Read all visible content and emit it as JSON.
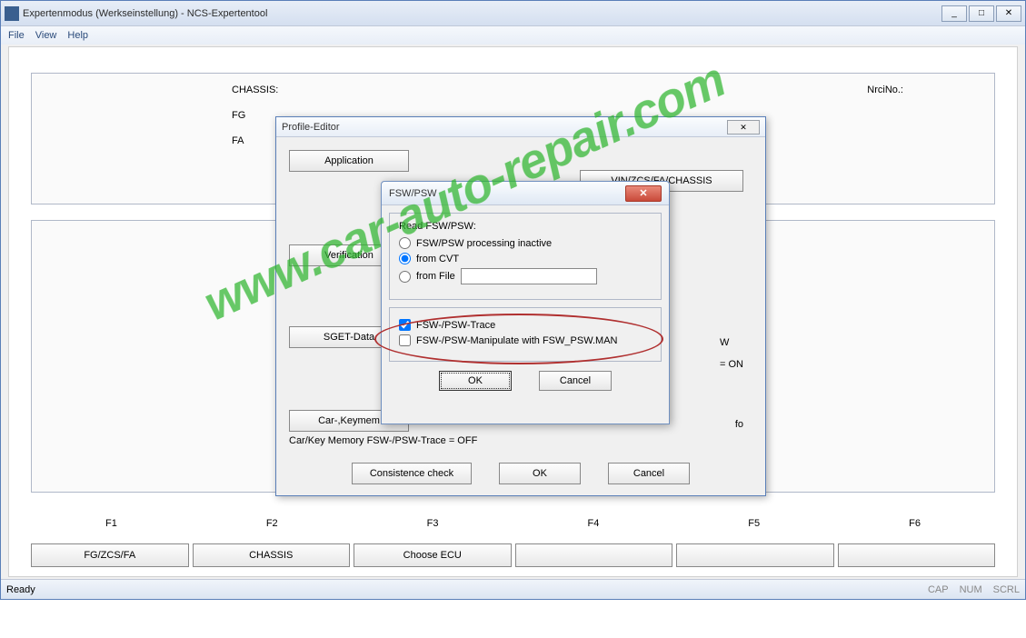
{
  "window": {
    "title": "Expertenmodus (Werkseinstellung) - NCS-Expertentool",
    "min": "_",
    "max": "□",
    "close": "✕"
  },
  "menu": {
    "file": "File",
    "view": "View",
    "help": "Help"
  },
  "main": {
    "chassis_label": "CHASSIS:",
    "nrcino_label": "NrciNo.:",
    "fg": "FG",
    "fa": "FA"
  },
  "fkeys": {
    "f1": "F1",
    "f2": "F2",
    "f3": "F3",
    "f4": "F4",
    "f5": "F5",
    "f6": "F6"
  },
  "fbuttons": {
    "b1": "FG/ZCS/FA",
    "b2": "CHASSIS",
    "b3": "Choose ECU",
    "b4": "",
    "b5": "",
    "b6": ""
  },
  "status": {
    "ready": "Ready",
    "cap": "CAP",
    "num": "NUM",
    "scrl": "SCRL"
  },
  "profile": {
    "title": "Profile-Editor",
    "close": "✕",
    "application": "Application",
    "vin": "VIN/ZCS/FA/CHASSIS",
    "verification": "Verification",
    "sget": "SGET-Data",
    "carkey": "Car-,Keymem",
    "info": "fo",
    "w_side": "W",
    "on_side": "= ON",
    "carkey_trace": "Car/Key Memory FSW-/PSW-Trace = OFF",
    "consistence": "Consistence check",
    "ok": "OK",
    "cancel": "Cancel"
  },
  "fsw": {
    "title": "FSW/PSW",
    "close": "✕",
    "read_label": "Read FSW/PSW:",
    "r1": "FSW/PSW processing inactive",
    "r2": "from CVT",
    "r3": "from File",
    "trace": "FSW-/PSW-Trace",
    "manip": "FSW-/PSW-Manipulate with FSW_PSW.MAN",
    "ok": "OK",
    "cancel": "Cancel"
  },
  "watermark": "www.car-auto-repair.com"
}
